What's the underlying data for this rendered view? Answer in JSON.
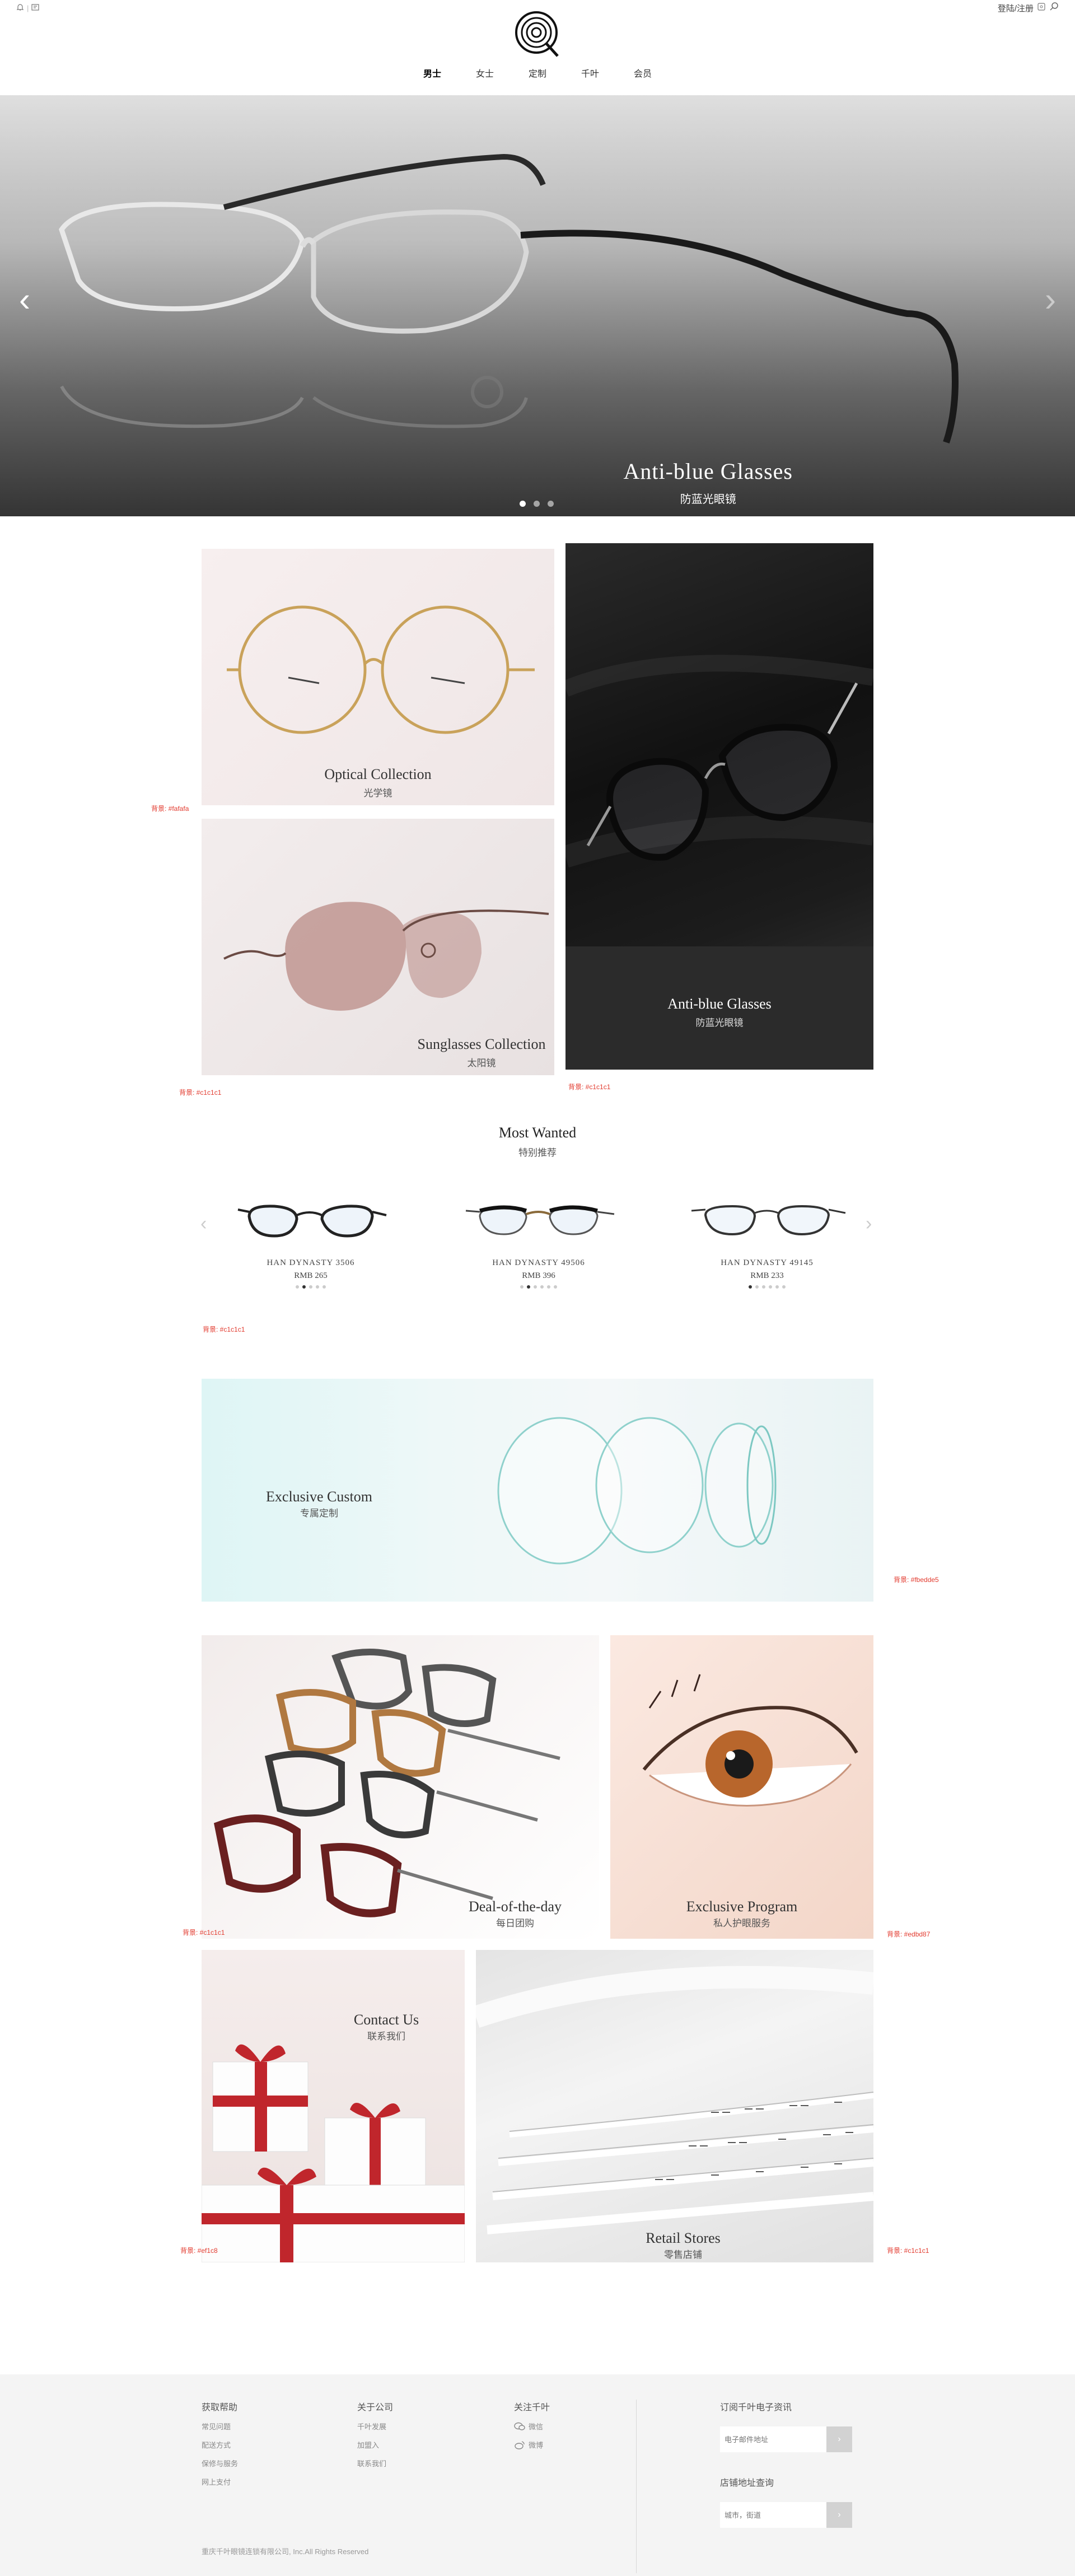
{
  "topbar": {
    "login_register": "登陆/注册"
  },
  "nav": {
    "items": [
      "男士",
      "女士",
      "定制",
      "千叶",
      "会员"
    ]
  },
  "hero": {
    "title": "Anti-blue Glasses",
    "subtitle": "防蓝光眼镜",
    "slides": 3,
    "active_slide": 1
  },
  "tiles": {
    "optical": {
      "title": "Optical Collection",
      "subtitle": "光学镜",
      "bg_note": "背景: #fafafa"
    },
    "sunglasses": {
      "title": "Sunglasses Collection",
      "subtitle": "太阳镜",
      "bg_note": "背景: #c1c1c1"
    },
    "antiblue": {
      "title": "Anti-blue Glasses",
      "subtitle": "防蓝光眼镜",
      "bg_note": "背景: #c1c1c1"
    }
  },
  "most_wanted": {
    "title": "Most Wanted",
    "subtitle": "特别推荐",
    "bg_note": "背景: #c1c1c1",
    "products": [
      {
        "name": "HAN DYNASTY 3506",
        "price": "RMB 265"
      },
      {
        "name": "HAN DYNASTY 49506",
        "price": "RMB 396"
      },
      {
        "name": "HAN DYNASTY 49145",
        "price": "RMB 233"
      }
    ]
  },
  "custom": {
    "title": "Exclusive Custom",
    "subtitle": "专属定制",
    "bg_note": "背景: #fbedde5"
  },
  "deal": {
    "title": "Deal-of-the-day",
    "subtitle": "每日团购",
    "bg_note": "背景: #c1c1c1"
  },
  "program": {
    "title": "Exclusive Program",
    "subtitle": "私人护眼服务",
    "bg_note": "背景: #edbd87"
  },
  "contact": {
    "title": "Contact Us",
    "subtitle": "联系我们",
    "bg_note": "背景: #ef1c8"
  },
  "retail": {
    "title": "Retail Stores",
    "subtitle": "零售店铺",
    "bg_note": "背景: #c1c1c1"
  },
  "footer": {
    "help": {
      "title": "获取帮助",
      "links": [
        "常见问题",
        "配送方式",
        "保修与服务",
        "网上支付"
      ]
    },
    "about": {
      "title": "关于公司",
      "links": [
        "千叶发展",
        "加盟入",
        "联系我们"
      ]
    },
    "follow": {
      "title": "关注千叶",
      "links": [
        "微信",
        "微博"
      ]
    },
    "newsletter": {
      "title": "订阅千叶电子资讯",
      "placeholder": "电子邮件地址"
    },
    "store": {
      "title": "店铺地址查询",
      "placeholder": "城市，街道"
    },
    "copyright": "重庆千叶眼镜连锁有限公司, Inc.All Rights Reserved"
  },
  "colors": {
    "accent_note": "#e23a2e",
    "footer_bg": "#f4f4f4"
  }
}
